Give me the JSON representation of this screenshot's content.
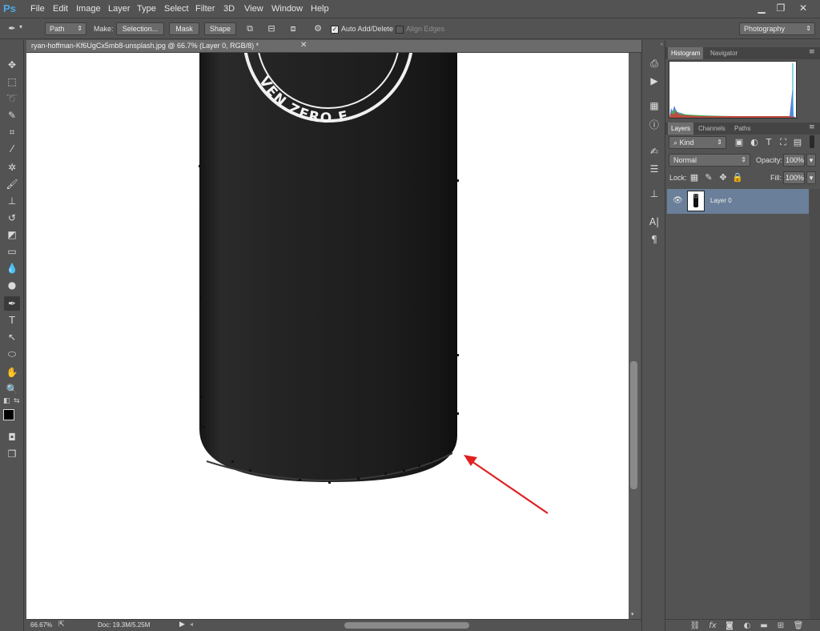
{
  "app": {
    "logo": "Ps"
  },
  "menu": [
    "File",
    "Edit",
    "Image",
    "Layer",
    "Type",
    "Select",
    "Filter",
    "3D",
    "View",
    "Window",
    "Help"
  ],
  "window_controls": {
    "minimize": "▁",
    "restore": "❐",
    "close": "✕"
  },
  "options": {
    "mode": "Path",
    "make_label": "Make:",
    "selection_button": "Selection...",
    "mask_button": "Mask",
    "shape_button": "Shape",
    "auto_add_delete": "Auto Add/Delete",
    "auto_add_delete_checked": true,
    "align_edges": "Align Edges",
    "align_edges_checked": false,
    "workspace": "Photography"
  },
  "document": {
    "tab_title": "ryan-hoffman-Kf6UgCx5mb8-unsplash.jpg @ 66.7% (Layer 0, RGB/8) *",
    "bottle_text": "VEN ZERO F",
    "zoom": "66.67%",
    "doc_size": "Doc: 19.3M/5.25M"
  },
  "panels": {
    "top_tabs": [
      "Histogram",
      "Navigator"
    ],
    "layers_tabs": [
      "Layers",
      "Channels",
      "Paths"
    ],
    "filter_kind": "Kind",
    "blend_mode": "Normal",
    "opacity_label": "Opacity:",
    "opacity_value": "100%",
    "lock_label": "Lock:",
    "fill_label": "Fill:",
    "fill_value": "100%",
    "layers": [
      {
        "name": "Layer 0",
        "visible": true
      }
    ]
  },
  "colors": {
    "accent_arrow": "#e02020",
    "selected_layer": "#6a7f99",
    "ui_bg": "#535353"
  }
}
